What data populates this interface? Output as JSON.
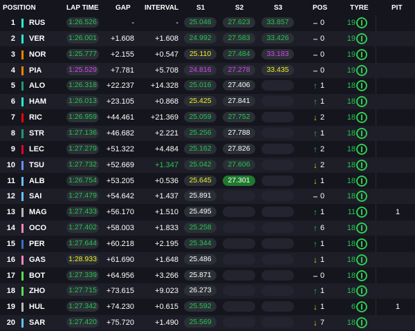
{
  "header": {
    "position": "POSITION",
    "lap_time": "LAP TIME",
    "gap": "GAP",
    "interval": "INTERVAL",
    "s1": "S1",
    "s2": "S2",
    "s3": "S3",
    "pos": "POS",
    "tyre": "TYRE",
    "pit": "PIT"
  },
  "colors": {
    "green": "#21c94e",
    "purple": "#e040fb",
    "yellow": "#f2ee24",
    "white": "#ffffff",
    "arrow_up": "#21c94e",
    "arrow_down": "#f5c518"
  },
  "rows": [
    {
      "pos": "1",
      "team_color": "#27f4d2",
      "driver": "RUS",
      "lap": "1:26.526",
      "lap_color": "green",
      "gap": "-",
      "interval": "-",
      "interval_color": "white",
      "s1": "25.046",
      "s1_color": "green",
      "s2": "27.623",
      "s2_color": "green",
      "s3": "33.857",
      "s3_color": "green",
      "arrow": "–",
      "arrow_dir": "none",
      "pos_change": "0",
      "tyre_laps": "19",
      "pit": ""
    },
    {
      "pos": "2",
      "team_color": "#27f4d2",
      "driver": "VER",
      "lap": "1:26.001",
      "lap_color": "green",
      "gap": "+1.608",
      "interval": "+1.608",
      "interval_color": "white",
      "s1": "24.992",
      "s1_color": "green",
      "s2": "27.583",
      "s2_color": "green",
      "s3": "33.426",
      "s3_color": "green",
      "arrow": "–",
      "arrow_dir": "none",
      "pos_change": "0",
      "tyre_laps": "19",
      "pit": ""
    },
    {
      "pos": "3",
      "team_color": "#ff8000",
      "driver": "NOR",
      "lap": "1:25.777",
      "lap_color": "green",
      "gap": "+2.155",
      "interval": "+0.547",
      "interval_color": "white",
      "s1": "25.110",
      "s1_color": "yellow",
      "s2": "27.484",
      "s2_color": "green",
      "s3": "33.183",
      "s3_color": "purple",
      "arrow": "–",
      "arrow_dir": "none",
      "pos_change": "0",
      "tyre_laps": "19",
      "pit": ""
    },
    {
      "pos": "4",
      "team_color": "#ff8000",
      "driver": "PIA",
      "lap": "1:25.529",
      "lap_color": "purple",
      "gap": "+7.781",
      "interval": "+5.708",
      "interval_color": "white",
      "s1": "24.816",
      "s1_color": "purple",
      "s2": "27.278",
      "s2_color": "purple",
      "s3": "33.435",
      "s3_color": "yellow",
      "arrow": "–",
      "arrow_dir": "none",
      "pos_change": "0",
      "tyre_laps": "19",
      "pit": ""
    },
    {
      "pos": "5",
      "team_color": "#229971",
      "driver": "ALO",
      "lap": "1:26.318",
      "lap_color": "green",
      "gap": "+22.237",
      "interval": "+14.328",
      "interval_color": "white",
      "s1": "25.016",
      "s1_color": "green",
      "s2": "27.406",
      "s2_color": "white",
      "s3": "",
      "s3_color": "white",
      "arrow": "↑",
      "arrow_dir": "up",
      "pos_change": "1",
      "tyre_laps": "18",
      "pit": ""
    },
    {
      "pos": "6",
      "team_color": "#27f4d2",
      "driver": "HAM",
      "lap": "1:26.013",
      "lap_color": "green",
      "gap": "+23.105",
      "interval": "+0.868",
      "interval_color": "white",
      "s1": "25.425",
      "s1_color": "yellow",
      "s2": "27.841",
      "s2_color": "white",
      "s3": "",
      "s3_color": "white",
      "arrow": "↑",
      "arrow_dir": "up",
      "pos_change": "1",
      "tyre_laps": "18",
      "pit": ""
    },
    {
      "pos": "7",
      "team_color": "#ff0000",
      "driver": "RIC",
      "lap": "1:26.959",
      "lap_color": "green",
      "gap": "+44.461",
      "interval": "+21.369",
      "interval_color": "white",
      "s1": "25.059",
      "s1_color": "green",
      "s2": "27.752",
      "s2_color": "green",
      "s3": "",
      "s3_color": "white",
      "arrow": "↓",
      "arrow_dir": "down",
      "pos_change": "2",
      "tyre_laps": "18",
      "pit": ""
    },
    {
      "pos": "8",
      "team_color": "#229971",
      "driver": "STR",
      "lap": "1:27.136",
      "lap_color": "green",
      "gap": "+46.682",
      "interval": "+2.221",
      "interval_color": "white",
      "s1": "25.256",
      "s1_color": "green",
      "s2": "27.788",
      "s2_color": "white",
      "s3": "",
      "s3_color": "white",
      "arrow": "↑",
      "arrow_dir": "up",
      "pos_change": "1",
      "tyre_laps": "18",
      "pit": ""
    },
    {
      "pos": "9",
      "team_color": "#e8002d",
      "driver": "LEC",
      "lap": "1:27.279",
      "lap_color": "green",
      "gap": "+51.322",
      "interval": "+4.484",
      "interval_color": "white",
      "s1": "25.162",
      "s1_color": "green",
      "s2": "27.826",
      "s2_color": "white",
      "s3": "",
      "s3_color": "white",
      "arrow": "↑",
      "arrow_dir": "up",
      "pos_change": "2",
      "tyre_laps": "18",
      "pit": ""
    },
    {
      "pos": "10",
      "team_color": "#6692ff",
      "driver": "TSU",
      "lap": "1:27.732",
      "lap_color": "green",
      "gap": "+52.669",
      "interval": "+1.347",
      "interval_color": "green",
      "s1": "25.042",
      "s1_color": "green",
      "s2": "27.606",
      "s2_color": "green",
      "s3": "",
      "s3_color": "white",
      "arrow": "↓",
      "arrow_dir": "down",
      "pos_change": "2",
      "tyre_laps": "18",
      "pit": ""
    },
    {
      "pos": "11",
      "team_color": "#64c4ff",
      "driver": "ALB",
      "lap": "1:26.754",
      "lap_color": "green",
      "gap": "+53.205",
      "interval": "+0.536",
      "interval_color": "white",
      "s1": "25.645",
      "s1_color": "yellow",
      "s2": "27.301",
      "s2_color": "green_fill",
      "s3": "",
      "s3_color": "white",
      "arrow": "↓",
      "arrow_dir": "down",
      "pos_change": "1",
      "tyre_laps": "18",
      "pit": ""
    },
    {
      "pos": "12",
      "team_color": "#64c4ff",
      "driver": "SAI",
      "lap": "1:27.479",
      "lap_color": "green",
      "gap": "+54.642",
      "interval": "+1.437",
      "interval_color": "white",
      "s1": "25.891",
      "s1_color": "white",
      "s2": "",
      "s2_color": "white",
      "s3": "",
      "s3_color": "white",
      "arrow": "–",
      "arrow_dir": "none",
      "pos_change": "0",
      "tyre_laps": "18",
      "pit": ""
    },
    {
      "pos": "13",
      "team_color": "#b6babd",
      "driver": "MAG",
      "lap": "1:27.433",
      "lap_color": "green",
      "gap": "+56.170",
      "interval": "+1.510",
      "interval_color": "white",
      "s1": "25.495",
      "s1_color": "white",
      "s2": "",
      "s2_color": "white",
      "s3": "",
      "s3_color": "white",
      "arrow": "↑",
      "arrow_dir": "up",
      "pos_change": "1",
      "tyre_laps": "11",
      "pit": "1"
    },
    {
      "pos": "14",
      "team_color": "#ff87bc",
      "driver": "OCO",
      "lap": "1:27.402",
      "lap_color": "green",
      "gap": "+58.003",
      "interval": "+1.833",
      "interval_color": "white",
      "s1": "25.258",
      "s1_color": "green",
      "s2": "",
      "s2_color": "white",
      "s3": "",
      "s3_color": "white",
      "arrow": "↑",
      "arrow_dir": "up",
      "pos_change": "6",
      "tyre_laps": "18",
      "pit": ""
    },
    {
      "pos": "15",
      "team_color": "#3671c6",
      "driver": "PER",
      "lap": "1:27.644",
      "lap_color": "green",
      "gap": "+60.218",
      "interval": "+2.195",
      "interval_color": "white",
      "s1": "25.344",
      "s1_color": "green",
      "s2": "",
      "s2_color": "white",
      "s3": "",
      "s3_color": "white",
      "arrow": "↑",
      "arrow_dir": "up",
      "pos_change": "1",
      "tyre_laps": "18",
      "pit": ""
    },
    {
      "pos": "16",
      "team_color": "#ff87bc",
      "driver": "GAS",
      "lap": "1:28.933",
      "lap_color": "yellow",
      "gap": "+61.690",
      "interval": "+1.648",
      "interval_color": "white",
      "s1": "25.486",
      "s1_color": "white",
      "s2": "",
      "s2_color": "white",
      "s3": "",
      "s3_color": "white",
      "arrow": "↓",
      "arrow_dir": "down",
      "pos_change": "1",
      "tyre_laps": "18",
      "pit": ""
    },
    {
      "pos": "17",
      "team_color": "#52e252",
      "driver": "BOT",
      "lap": "1:27.339",
      "lap_color": "green",
      "gap": "+64.956",
      "interval": "+3.266",
      "interval_color": "white",
      "s1": "25.871",
      "s1_color": "white",
      "s2": "",
      "s2_color": "white",
      "s3": "",
      "s3_color": "white",
      "arrow": "–",
      "arrow_dir": "none",
      "pos_change": "0",
      "tyre_laps": "18",
      "pit": ""
    },
    {
      "pos": "18",
      "team_color": "#52e252",
      "driver": "ZHO",
      "lap": "1:27.715",
      "lap_color": "green",
      "gap": "+73.615",
      "interval": "+9.023",
      "interval_color": "white",
      "s1": "26.273",
      "s1_color": "white",
      "s2": "",
      "s2_color": "white",
      "s3": "",
      "s3_color": "white",
      "arrow": "↑",
      "arrow_dir": "up",
      "pos_change": "1",
      "tyre_laps": "18",
      "pit": ""
    },
    {
      "pos": "19",
      "team_color": "#b6babd",
      "driver": "HUL",
      "lap": "1:27.342",
      "lap_color": "green",
      "gap": "+74.230",
      "interval": "+0.615",
      "interval_color": "white",
      "s1": "25.592",
      "s1_color": "green",
      "s2": "",
      "s2_color": "white",
      "s3": "",
      "s3_color": "white",
      "arrow": "↓",
      "arrow_dir": "down",
      "pos_change": "1",
      "tyre_laps": "6",
      "pit": "1"
    },
    {
      "pos": "20",
      "team_color": "#64c4ff",
      "driver": "SAR",
      "lap": "1:27.420",
      "lap_color": "green",
      "gap": "+75.720",
      "interval": "+1.490",
      "interval_color": "white",
      "s1": "25.569",
      "s1_color": "green",
      "s2": "",
      "s2_color": "white",
      "s3": "",
      "s3_color": "white",
      "arrow": "↓",
      "arrow_dir": "down",
      "pos_change": "7",
      "tyre_laps": "18",
      "pit": ""
    }
  ]
}
